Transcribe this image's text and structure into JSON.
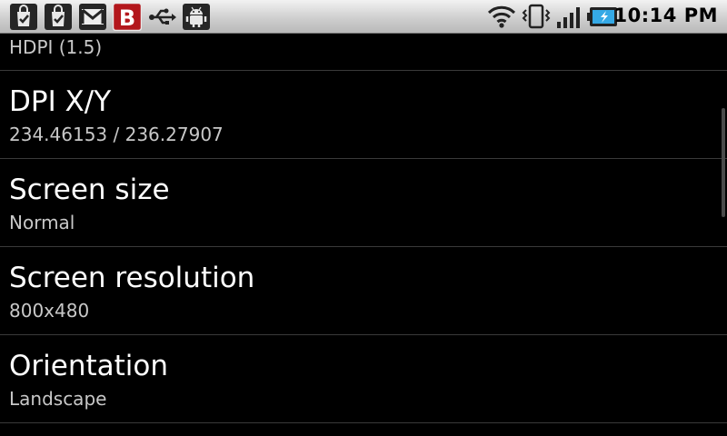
{
  "status_bar": {
    "notification_icons": [
      "shopping-bag-icon",
      "shopping-bag-icon",
      "gmail-icon",
      "b-app-icon",
      "usb-icon",
      "android-debug-icon"
    ],
    "system_icons": [
      "wifi-icon",
      "vibrate-icon",
      "signal-icon",
      "battery-charging-icon"
    ],
    "time": "10:14 PM"
  },
  "list": {
    "partial_item": {
      "summary": "HDPI (1.5)"
    },
    "items": [
      {
        "title": "DPI X/Y",
        "summary": "234.46153 / 236.27907"
      },
      {
        "title": "Screen size",
        "summary": "Normal"
      },
      {
        "title": "Screen resolution",
        "summary": "800x480"
      },
      {
        "title": "Orientation",
        "summary": "Landscape"
      }
    ]
  },
  "colors": {
    "background": "#000000",
    "title_text": "#ffffff",
    "summary_text": "#c8c8c8",
    "divider": "#3a3a3a",
    "status_bar": "#d8d8d8",
    "b_icon_red": "#b3171c"
  }
}
